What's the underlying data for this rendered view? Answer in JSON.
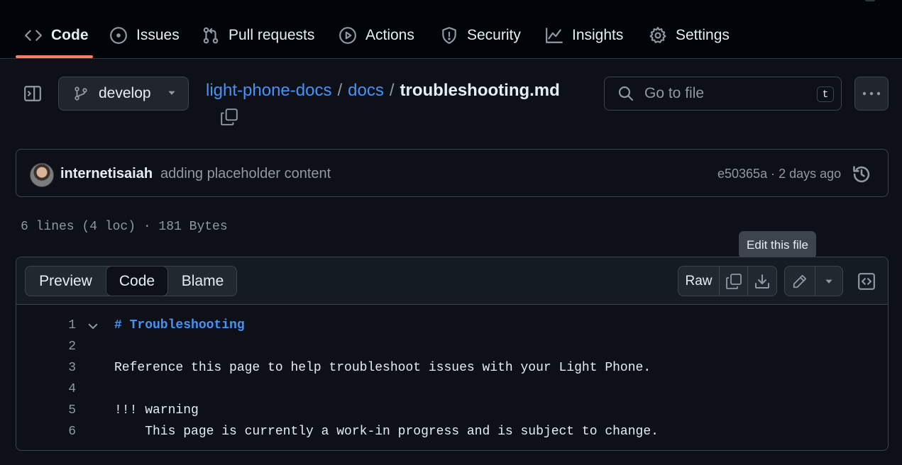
{
  "nav": {
    "tabs": [
      {
        "label": "Code",
        "icon": "code-icon"
      },
      {
        "label": "Issues",
        "icon": "issue-icon"
      },
      {
        "label": "Pull requests",
        "icon": "pull-request-icon"
      },
      {
        "label": "Actions",
        "icon": "play-icon"
      },
      {
        "label": "Security",
        "icon": "shield-icon"
      },
      {
        "label": "Insights",
        "icon": "graph-icon"
      },
      {
        "label": "Settings",
        "icon": "gear-icon"
      }
    ],
    "active_tab": "Code"
  },
  "file_header": {
    "branch": "develop",
    "breadcrumb": {
      "repo": "light-phone-docs",
      "folder": "docs",
      "separator": "/",
      "file": "troubleshooting.md"
    },
    "search": {
      "placeholder": "Go to file",
      "shortcut": "t"
    }
  },
  "commit": {
    "author": "internetisaiah",
    "message": "adding placeholder content",
    "meta": "e50365a · 2 days ago"
  },
  "file_info": "6 lines (4 loc) · 181 Bytes",
  "tooltip": "Edit this file",
  "viewer": {
    "tabs": [
      "Preview",
      "Code",
      "Blame"
    ],
    "active_tab": "Code",
    "raw_label": "Raw"
  },
  "code_lines": [
    {
      "n": "1",
      "text": "# Troubleshooting",
      "style": "heading"
    },
    {
      "n": "2",
      "text": "",
      "style": "normal"
    },
    {
      "n": "3",
      "text": "Reference this page to help troubleshoot issues with your Light Phone.",
      "style": "normal"
    },
    {
      "n": "4",
      "text": "",
      "style": "normal"
    },
    {
      "n": "5",
      "text": "!!! warning",
      "style": "normal"
    },
    {
      "n": "6",
      "text": "    This page is currently a work-in progress and is subject to change.",
      "style": "normal"
    }
  ],
  "colors": {
    "background": "#0d1117",
    "nav_background": "#010409",
    "accent_link": "#4493f8",
    "active_underline": "#f78166",
    "muted_text": "#9198a1",
    "border": "#3d444d"
  }
}
